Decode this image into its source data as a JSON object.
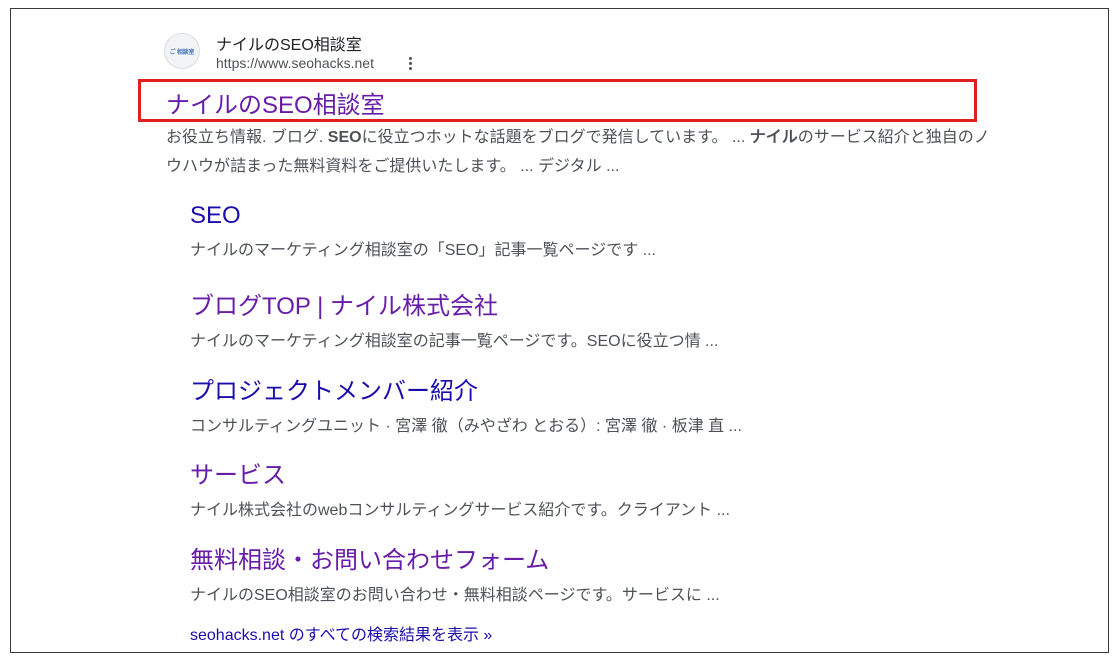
{
  "site": {
    "favicon_text": "ご 相談室",
    "name": "ナイルのSEO相談室",
    "url": "https://www.seohacks.net"
  },
  "result": {
    "title": "ナイルのSEO相談室",
    "snippet_parts": [
      "お役立ち情報. ブログ. ",
      "SEO",
      "に役立つホットな話題をブログで発信しています。 ... ",
      "ナイル",
      "のサービス紹介と独自のノウハウが詰まった無料資料をご提供いたします。 ... デジタル ..."
    ]
  },
  "sitelinks": [
    {
      "title": "SEO",
      "desc": "ナイルのマーケティング相談室の「SEO」記事一覧ページです ..."
    },
    {
      "title": "ブログTOP | ナイル株式会社",
      "desc": "ナイルのマーケティング相談室の記事一覧ページです。SEOに役立つ情 ..."
    },
    {
      "title": "プロジェクトメンバー紹介",
      "desc": "コンサルティングユニット · 宮澤 徹（みやざわ とおる）: 宮澤 徹 · 板津 直 ..."
    },
    {
      "title": "サービス",
      "desc": "ナイル株式会社のwebコンサルティングサービス紹介です。クライアント ..."
    },
    {
      "title": "無料相談・お問い合わせフォーム",
      "desc": "ナイルのSEO相談室のお問い合わせ・無料相談ページです。サービスに ..."
    }
  ],
  "more_results": "seohacks.net のすべての検索結果を表示 »",
  "colors": {
    "visited_link": "#681da8",
    "link": "#1a0dab",
    "highlight_border": "#e0201e",
    "text_secondary": "#4d5156"
  }
}
